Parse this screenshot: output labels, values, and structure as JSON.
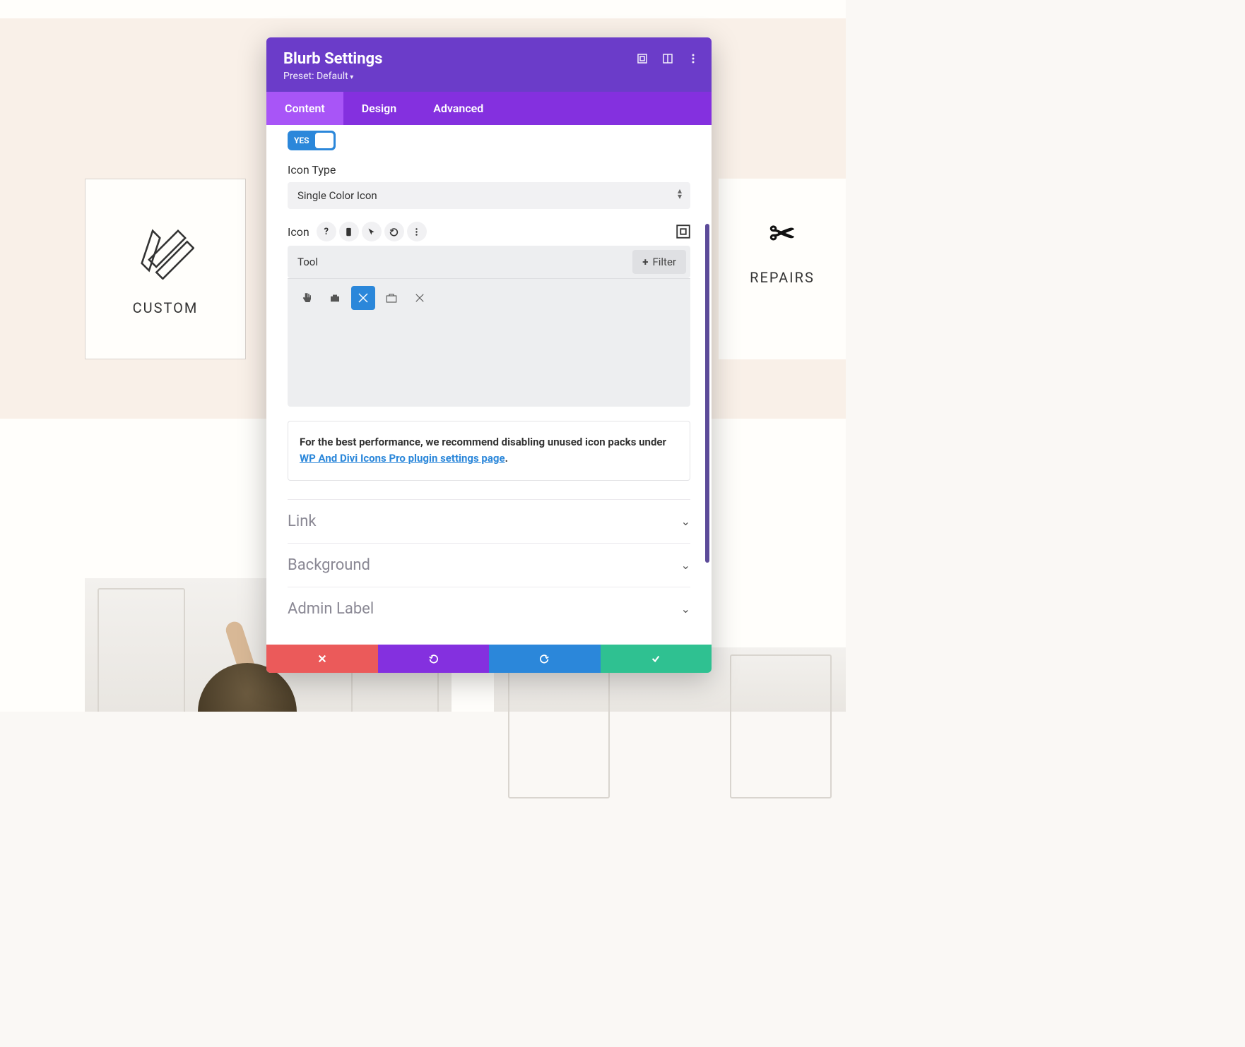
{
  "background_cards": {
    "left": {
      "label": "CUSTOM"
    },
    "right": {
      "label": "REPAIRS"
    }
  },
  "modal": {
    "title": "Blurb Settings",
    "preset": "Preset: Default",
    "tabs": {
      "content": "Content",
      "design": "Design",
      "advanced": "Advanced"
    },
    "toggle": {
      "value": "YES"
    },
    "icon_type": {
      "label": "Icon Type",
      "value": "Single Color Icon"
    },
    "icon_section": {
      "label": "Icon"
    },
    "search": {
      "value": "Tool"
    },
    "filter_button": "Filter",
    "notice": {
      "prefix": "For the best performance, we recommend disabling unused icon packs under ",
      "link": "WP And Divi Icons Pro plugin settings page",
      "suffix": "."
    },
    "accordion": {
      "link": "Link",
      "background": "Background",
      "admin_label": "Admin Label"
    }
  }
}
